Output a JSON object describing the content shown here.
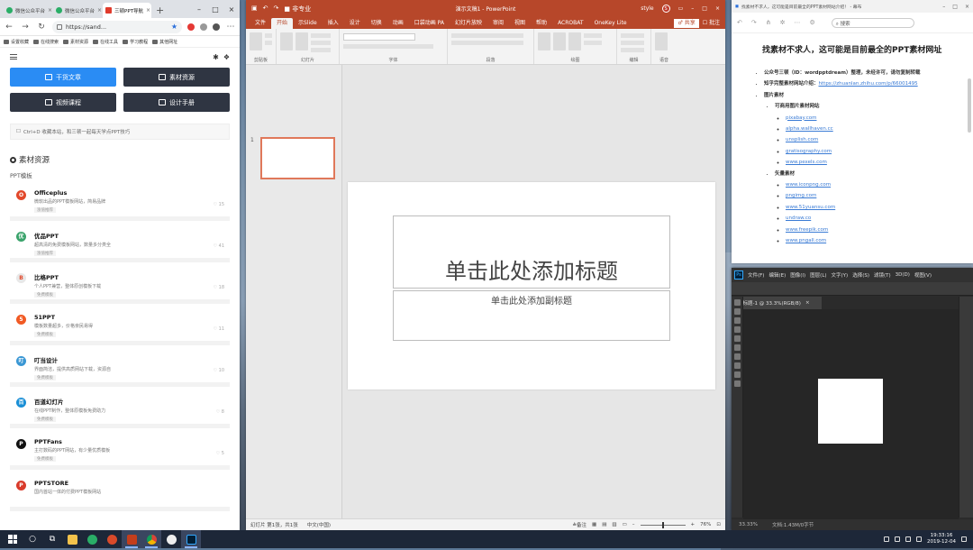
{
  "browser": {
    "tabs": [
      {
        "label": "微信公众平台"
      },
      {
        "label": "微信公众平台"
      },
      {
        "label": "三顿PPT导航"
      }
    ],
    "url": "https://sand...",
    "bookmarks": [
      "设置收藏",
      "在线搜索",
      "素材资源",
      "在线工具",
      "学习教程",
      "其他网址"
    ],
    "buttons": [
      {
        "label": "干货文章"
      },
      {
        "label": "素材资源"
      },
      {
        "label": "视频课程"
      },
      {
        "label": "设计手册"
      }
    ],
    "tip": "Ctrl+D 收藏本站，和三顿一起每天学点PPT技巧",
    "section_title": "素材资源",
    "subsection": "PPT模板",
    "resources": [
      {
        "name": "Officeplus",
        "desc": "微软出品的PPT模板网站，简易品牌",
        "tag": "涨值推荐",
        "likes": "♡ 15",
        "color": "#e2482b",
        "letter": "O"
      },
      {
        "name": "优品PPT",
        "desc": "超高清的免费模板网站，数量多分类全",
        "tag": "涨值推荐",
        "likes": "♡ 41",
        "color": "#3aa36b",
        "letter": "优"
      },
      {
        "name": "比格PPT",
        "desc": "个人PPT兼营，整体原创模板下载",
        "tag": "免费模板",
        "likes": "♡ 18",
        "color": "#e8e8e8",
        "letter": "B"
      },
      {
        "name": "51PPT",
        "desc": "模板数量超多，价格亲民易得",
        "tag": "免费模板",
        "likes": "♡ 11",
        "color": "#f15a24",
        "letter": "5"
      },
      {
        "name": "叮当设计",
        "desc": "界面简洁，提供高质网站下载，资源自",
        "tag": "免费模板",
        "likes": "♡ 10",
        "color": "#3a97d4",
        "letter": "叮"
      },
      {
        "name": "百道幻灯片",
        "desc": "在线PPT制作，整体原模板免费助力",
        "tag": "免费模板",
        "likes": "♡ 8",
        "color": "#1a8fd6",
        "letter": "百"
      },
      {
        "name": "PPTFans",
        "desc": "主打数码的PPT网站，有少量优质模板",
        "tag": "免费模板",
        "likes": "♡ 5",
        "color": "#111111",
        "letter": "P"
      },
      {
        "name": "PPTSTORE",
        "desc": "国内首站一体的付费PPT模板网站",
        "tag": "",
        "likes": "",
        "color": "#d93b2b",
        "letter": "P"
      }
    ]
  },
  "ppt": {
    "qa_label": "■ 非专业",
    "doc_title": "演示文稿1 - PowerPoint",
    "user": "style",
    "avatar_letter": "S",
    "tabs": [
      "文件",
      "开始",
      "示Slide",
      "插入",
      "设计",
      "切换",
      "动画",
      "口袋动画 PA",
      "幻灯片放映",
      "审阅",
      "视图",
      "帮助",
      "ACROBAT",
      "OneKey Lite"
    ],
    "active_tab": 1,
    "share": "♂ 共享",
    "comments": "☐ 批注",
    "ribbon_groups": [
      "剪贴板",
      "幻灯片",
      "字体",
      "段落",
      "绘图",
      "编辑",
      "语音"
    ],
    "slide_number": "1",
    "title_placeholder": "单击此处添加标题",
    "subtitle_placeholder": "单击此处添加副标题",
    "status_left": "幻灯片 第1张，共1张",
    "status_lang": "中文(中国)",
    "status_notes": "≙备注",
    "zoom": "76%"
  },
  "notes": {
    "window_title": "找素材不求人，这可能是目前最全的PPT素材网站介绍！ - 幕布",
    "search_placeholder": "搜索",
    "heading": "找素材不求人，这可能是目前最全的PPT素材网址",
    "items": [
      {
        "text": "公众号三顿（ID：wordpptdream）整理，未经许可，请勿复制转载"
      },
      {
        "text": "知乎完整素材网站介绍：",
        "link": "https://zhuanlan.zhihu.com/p/66001495"
      },
      {
        "text": "图片素材"
      }
    ],
    "sub_items": [
      {
        "text": "可商用图片素材网站",
        "links": [
          "pixabay.com",
          "alpha.wallhaven.cc",
          "unsplish.com",
          "gratisography.com",
          "www.pexels.com"
        ]
      },
      {
        "text": "矢量素材",
        "links": [
          "www.iconpng.com",
          "pngimg.com",
          "www.51yuansu.com",
          "undraw.co",
          "www.freepik.com",
          "www.pngall.com"
        ]
      }
    ]
  },
  "photoshop": {
    "menu": [
      "文件(F)",
      "编辑(E)",
      "图像(I)",
      "图层(L)",
      "文字(Y)",
      "选择(S)",
      "滤镜(T)",
      "3D(D)",
      "视图(V)"
    ],
    "doc_tab": "未标题-1 @ 33.3%(RGB/8)",
    "zoom": "33.33%",
    "doc_size": "文档:1.43M/0字节"
  },
  "taskbar": {
    "time": "19:33:16",
    "date": "2019-12-04"
  }
}
